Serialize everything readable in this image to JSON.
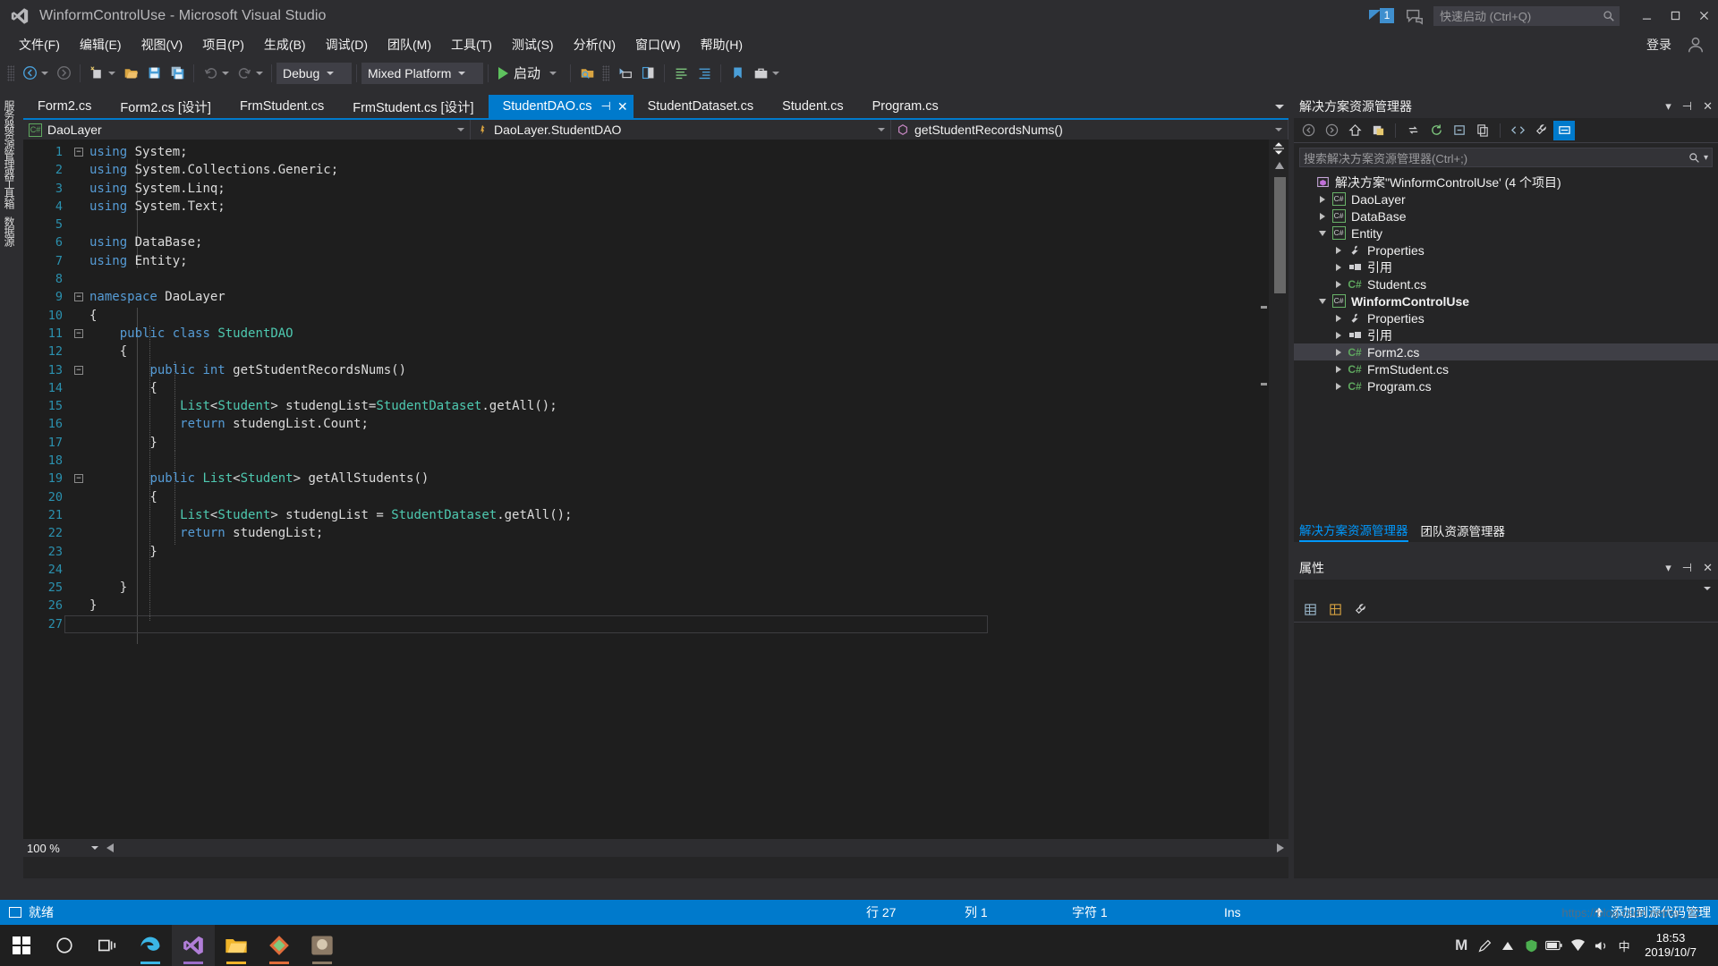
{
  "window": {
    "title": "WinformControlUse - Microsoft Visual Studio",
    "notification_count": "1",
    "quick_launch_placeholder": "快速启动 (Ctrl+Q)",
    "signin_label": "登录",
    "minimize_icon": "minimize-icon",
    "maximize_icon": "maximize-icon",
    "close_icon": "close-icon"
  },
  "menu": {
    "items": [
      {
        "label": "文件(F)"
      },
      {
        "label": "编辑(E)"
      },
      {
        "label": "视图(V)"
      },
      {
        "label": "项目(P)"
      },
      {
        "label": "生成(B)"
      },
      {
        "label": "调试(D)"
      },
      {
        "label": "团队(M)"
      },
      {
        "label": "工具(T)"
      },
      {
        "label": "测试(S)"
      },
      {
        "label": "分析(N)"
      },
      {
        "label": "窗口(W)"
      },
      {
        "label": "帮助(H)"
      }
    ]
  },
  "toolbar": {
    "nav_back_icon": "navigate-back-icon",
    "nav_forward_icon": "navigate-forward-icon",
    "new_project_icon": "new-project-icon",
    "open_file_icon": "open-file-icon",
    "save_icon": "save-icon",
    "save_all_icon": "save-all-icon",
    "undo_icon": "undo-icon",
    "redo_icon": "redo-icon",
    "config_value": "Debug",
    "platform_value": "Mixed Platform",
    "run_label": "启动",
    "find_icon": "find-in-files-icon",
    "attach_icon": "attach-to-process-icon",
    "compare_icon": "compare-files-icon",
    "list_icon": "task-list-icon",
    "indent_icon": "indent-icon",
    "bookmark_icon": "bookmark-icon",
    "toolbox_icon": "toolbox-icon"
  },
  "left_dock": {
    "tabs": [
      "服务器资源管理器",
      "工具箱",
      "数据源"
    ]
  },
  "editor": {
    "tabs": [
      {
        "label": "Form2.cs",
        "active": false
      },
      {
        "label": "Form2.cs [设计]",
        "active": false
      },
      {
        "label": "FrmStudent.cs",
        "active": false
      },
      {
        "label": "FrmStudent.cs [设计]",
        "active": false
      },
      {
        "label": "StudentDAO.cs",
        "active": true,
        "pin_icon": "pin-icon",
        "close_icon": "close-tab-icon"
      },
      {
        "label": "StudentDataset.cs",
        "active": false
      },
      {
        "label": "Student.cs",
        "active": false
      },
      {
        "label": "Program.cs",
        "active": false
      }
    ],
    "overflow_icon": "chevron-down-icon",
    "nav": {
      "project": "DaoLayer",
      "type": "DaoLayer.StudentDAO",
      "member": "getStudentRecordsNums()",
      "project_icon": "csharp-project-icon",
      "type_icon": "class-icon",
      "member_icon": "method-icon"
    },
    "zoom": "100 %",
    "code_lines": [
      {
        "n": "1",
        "fold": "-",
        "text": "using System;"
      },
      {
        "n": "2",
        "fold": "",
        "text": "using System.Collections.Generic;"
      },
      {
        "n": "3",
        "fold": "",
        "text": "using System.Linq;"
      },
      {
        "n": "4",
        "fold": "",
        "text": "using System.Text;"
      },
      {
        "n": "5",
        "fold": "",
        "text": ""
      },
      {
        "n": "6",
        "fold": "",
        "text": "using DataBase;"
      },
      {
        "n": "7",
        "fold": "",
        "text": "using Entity;"
      },
      {
        "n": "8",
        "fold": "",
        "text": ""
      },
      {
        "n": "9",
        "fold": "-",
        "text": "namespace DaoLayer"
      },
      {
        "n": "10",
        "fold": "",
        "text": "{"
      },
      {
        "n": "11",
        "fold": "-",
        "text": "    public class StudentDAO"
      },
      {
        "n": "12",
        "fold": "",
        "text": "    {"
      },
      {
        "n": "13",
        "fold": "-",
        "text": "        public int getStudentRecordsNums()"
      },
      {
        "n": "14",
        "fold": "",
        "text": "        {"
      },
      {
        "n": "15",
        "fold": "",
        "text": "            List<Student> studengList=StudentDataset.getAll();"
      },
      {
        "n": "16",
        "fold": "",
        "text": "            return studengList.Count;"
      },
      {
        "n": "17",
        "fold": "",
        "text": "        }"
      },
      {
        "n": "18",
        "fold": "",
        "text": ""
      },
      {
        "n": "19",
        "fold": "-",
        "text": "        public List<Student> getAllStudents()"
      },
      {
        "n": "20",
        "fold": "",
        "text": "        {"
      },
      {
        "n": "21",
        "fold": "",
        "text": "            List<Student> studengList = StudentDataset.getAll();"
      },
      {
        "n": "22",
        "fold": "",
        "text": "            return studengList;"
      },
      {
        "n": "23",
        "fold": "",
        "text": "        }"
      },
      {
        "n": "24",
        "fold": "",
        "text": ""
      },
      {
        "n": "25",
        "fold": "",
        "text": "    }"
      },
      {
        "n": "26",
        "fold": "",
        "text": "}"
      },
      {
        "n": "27",
        "fold": "",
        "text": ""
      }
    ]
  },
  "solution_explorer": {
    "title": "解决方案资源管理器",
    "dropdown_icon": "chevron-down-icon",
    "pin_icon": "pin-icon",
    "close_icon": "close-icon",
    "toolbar_icons": [
      "back-icon",
      "forward-icon",
      "home-icon",
      "pending-changes-icon",
      "sync-with-active-document-icon",
      "refresh-icon",
      "collapse-all-icon",
      "show-all-files-icon",
      "view-code-icon",
      "properties-icon",
      "preview-selected-items-icon"
    ],
    "search_placeholder": "搜索解决方案资源管理器(Ctrl+;)",
    "search_icon": "search-icon",
    "search_dropdown_icon": "chevron-down-icon",
    "tree": [
      {
        "depth": 0,
        "twisty": "none",
        "icon": "solution-icon",
        "label": "解决方案\"WinformControlUse' (4 个项目)",
        "bold": false,
        "selected": false
      },
      {
        "depth": 1,
        "twisty": "right",
        "icon": "csproj-icon",
        "label": "DaoLayer",
        "bold": false,
        "selected": false
      },
      {
        "depth": 1,
        "twisty": "right",
        "icon": "csproj-icon",
        "label": "DataBase",
        "bold": false,
        "selected": false
      },
      {
        "depth": 1,
        "twisty": "down",
        "icon": "csproj-icon",
        "label": "Entity",
        "bold": false,
        "selected": false
      },
      {
        "depth": 2,
        "twisty": "right",
        "icon": "wrench-icon",
        "label": "Properties",
        "bold": false,
        "selected": false
      },
      {
        "depth": 2,
        "twisty": "right",
        "icon": "references-icon",
        "label": "引用",
        "bold": false,
        "selected": false
      },
      {
        "depth": 2,
        "twisty": "right",
        "icon": "csfile-icon",
        "label": "Student.cs",
        "bold": false,
        "selected": false
      },
      {
        "depth": 1,
        "twisty": "down",
        "icon": "csproj-icon",
        "label": "WinformControlUse",
        "bold": true,
        "selected": false
      },
      {
        "depth": 2,
        "twisty": "right",
        "icon": "wrench-icon",
        "label": "Properties",
        "bold": false,
        "selected": false
      },
      {
        "depth": 2,
        "twisty": "right",
        "icon": "references-icon",
        "label": "引用",
        "bold": false,
        "selected": false
      },
      {
        "depth": 2,
        "twisty": "right",
        "icon": "csfile-icon",
        "label": "Form2.cs",
        "bold": false,
        "selected": true
      },
      {
        "depth": 2,
        "twisty": "right",
        "icon": "csfile-icon",
        "label": "FrmStudent.cs",
        "bold": false,
        "selected": false
      },
      {
        "depth": 2,
        "twisty": "right",
        "icon": "csfile-icon",
        "label": "Program.cs",
        "bold": false,
        "selected": false
      }
    ],
    "bottom_tabs": [
      {
        "label": "解决方案资源管理器",
        "active": true
      },
      {
        "label": "团队资源管理器",
        "active": false
      }
    ]
  },
  "properties_panel": {
    "title": "属性",
    "dropdown_icon": "chevron-down-icon",
    "pin_icon": "pin-icon",
    "close_icon": "close-icon",
    "toolbar_icons": [
      "categorized-icon",
      "alphabetical-icon",
      "properties-icon"
    ]
  },
  "status_bar": {
    "ready": "就绪",
    "line_label": "行 27",
    "column_label": "列 1",
    "char_label": "字符 1",
    "insert_mode": "Ins",
    "source_control": "添加到源代码管理",
    "upload_icon": "upload-arrow-icon"
  },
  "taskbar": {
    "start_icon": "windows-start-icon",
    "search_icon": "cortana-search-icon",
    "taskview_icon": "task-view-icon",
    "apps": [
      {
        "name": "edge-icon",
        "accent": "#3bb6e6"
      },
      {
        "name": "visual-studio-icon",
        "accent": "#9b6ec8"
      },
      {
        "name": "explorer-icon",
        "accent": "#f0b429"
      },
      {
        "name": "app-colorful-icon",
        "accent": "#e06c3a"
      },
      {
        "name": "photo-app-icon",
        "accent": "#8c7a66"
      }
    ],
    "tray": [
      "M",
      "pen-icon",
      "chevron-up-icon",
      "shield-green-icon",
      "battery-icon",
      "network-icon",
      "volume-icon",
      "ime-icon"
    ],
    "clock_time": "18:53",
    "clock_date": "2019/10/7"
  },
  "watermark": "https://blog.csdn.net/sy_22",
  "colors": {
    "accent": "#007acc",
    "chrome": "#2d2d30",
    "editor_bg": "#1e1e1e",
    "keyword": "#569cd6",
    "type": "#4ec9b0",
    "linenum": "#2b91af",
    "plain": "#dcdcdc"
  }
}
